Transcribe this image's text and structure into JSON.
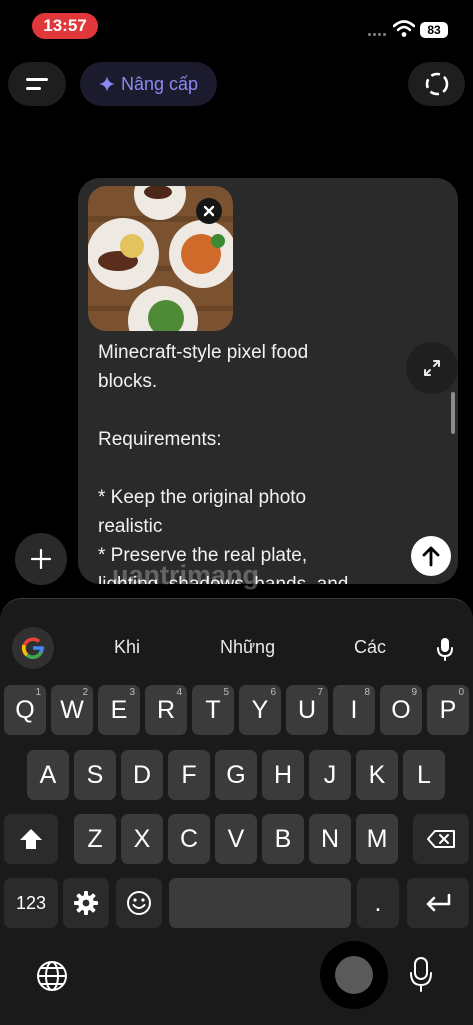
{
  "status": {
    "time": "13:57",
    "battery": "83"
  },
  "topbar": {
    "upgrade_label": "Nâng cấp"
  },
  "composer": {
    "prompt_text": "Minecraft-style pixel food\nblocks.\n\nRequirements:\n\n* Keep the original photo\nrealistic\n* Preserve the real plate,\nlighting, shadows, hands, and",
    "watermark": "uantrimang"
  },
  "keyboard": {
    "suggestions": [
      "Khi",
      "Những",
      "Các"
    ],
    "row1": [
      {
        "k": "Q",
        "n": "1"
      },
      {
        "k": "W",
        "n": "2"
      },
      {
        "k": "E",
        "n": "3"
      },
      {
        "k": "R",
        "n": "4"
      },
      {
        "k": "T",
        "n": "5"
      },
      {
        "k": "Y",
        "n": "6"
      },
      {
        "k": "U",
        "n": "7"
      },
      {
        "k": "I",
        "n": "8"
      },
      {
        "k": "O",
        "n": "9"
      },
      {
        "k": "P",
        "n": "0"
      }
    ],
    "row2": [
      "A",
      "S",
      "D",
      "F",
      "G",
      "H",
      "J",
      "K",
      "L"
    ],
    "row3": [
      "Z",
      "X",
      "C",
      "V",
      "B",
      "N",
      "M"
    ],
    "numbers_label": "123",
    "period_label": "."
  }
}
